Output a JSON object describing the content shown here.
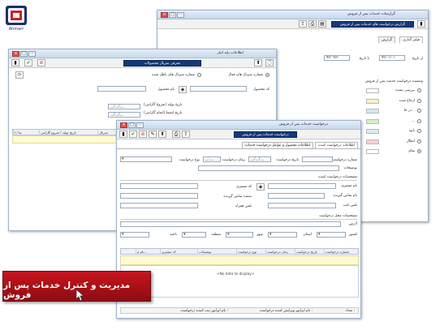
{
  "logo": {
    "caption": "Ahmarr"
  },
  "banner": {
    "text": "مدیریت و کنترل خدمات پس از فروش"
  },
  "win_reports": {
    "title": "گزارشات خدمات پس از فروش",
    "toolbar_title": "گزارش درخواست های خدمات پس از فروش",
    "tabs": [
      "فیلتر گذاری",
      "گزارش"
    ],
    "from_date_label": "از تاریخ",
    "from_date_value": "۹۳/۰۱/۰۱",
    "to_date_label": "تا تاریخ",
    "to_date_value": "۹۳/۰۹/۳۰",
    "status_header": "وضعیت درخواست خدمت پس از فروش",
    "status_options": [
      {
        "label": "بررسی نشده",
        "color": "#ffffff"
      },
      {
        "label": "ارجاع شده",
        "color": "#f7f3c6"
      },
      {
        "label": "در حا...",
        "color": "#cfe6f7"
      },
      {
        "label": "...",
        "color": "#d7f0c8"
      },
      {
        "label": "تایید",
        "color": "#dcecf7"
      },
      {
        "label": "ابطال",
        "color": "#f7cfd3"
      },
      {
        "label": "تمام",
        "color": "#ffffff"
      }
    ]
  },
  "win_base": {
    "title": "اطلاعات پایه انبار",
    "toolbar_title": "معرفی سریال محصولات",
    "radio_external": "شماره سریال های فعال",
    "radio_internal": "شماره سریال های باطل شده",
    "product_code_label": "کد محصول",
    "product_name_label": "نام محصول",
    "prod_date_label": "تاریخ تولید (شروع گارانتی)",
    "prod_date_value": "__/__/__",
    "end_date_label": "تاریخ انقضا (اتمام گارانتی)",
    "end_date_value": "__/__/__",
    "grid_headers": [
      "تاریخ تولید / شروع گارانتی",
      "تاریخ انقضا / ا..."
    ],
    "grid_header_serial": "سریال"
  },
  "win_request": {
    "title": "درخواست خدمات پس از فروش",
    "toolbar_title": "درخواست خدمات پس از فروش",
    "tabs": [
      "اطلاعات درخواست کننده",
      "اطلاعات محصول و عوامل درخواست خدمات"
    ],
    "req_number_label": "شماره درخواست",
    "req_date_label": "تاریخ درخواست",
    "req_date_value": "__/__/__",
    "req_time_label": "زمان درخواست",
    "req_time_value": "__:__",
    "req_type_label": "نوع درخواست",
    "desc_label": "توضیحات",
    "requester_section": "مشخصات درخواست کننده",
    "customer_name_label": "نام مشتری",
    "customer_code_label": "کد مشتری",
    "contact_name_label": "نام تماس گیرنده",
    "contact_post_label": "سمت تماس گیرنده",
    "phone_label": "تلفن ثابت",
    "mobile_label": "تلفن همراه",
    "location_section": "مشخصات محل درخواست",
    "address_label": "آدرس",
    "country_label": "کشور",
    "province_label": "استان",
    "city_label": "شهر",
    "region_label": "منطقه",
    "district_label": "ناحیه",
    "grid_headers": [
      "شماره درخواست",
      "تاریخ درخواست",
      "زمان درخواست",
      "نوع درخواست",
      "توضیحات",
      "کد مشتری",
      "نام م..."
    ],
    "no_data": "<No data to display>",
    "footer_count_label": "تعداد :",
    "footer_left": "نام اپراتور ثبت کننده درخواست :",
    "footer_mid": "نام اپراتور ویرایش کننده درخواست :"
  }
}
